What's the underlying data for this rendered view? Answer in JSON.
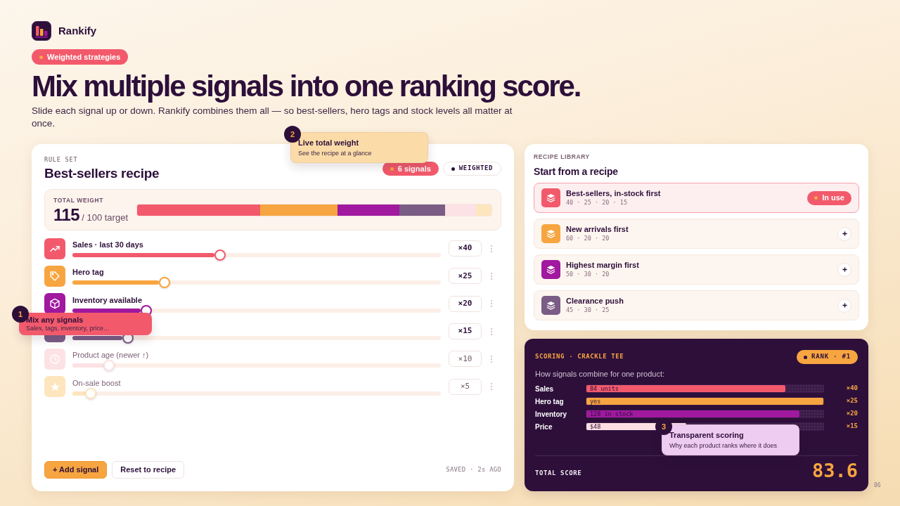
{
  "brand": {
    "name": "Rankify"
  },
  "hero": {
    "tag": "Weighted strategies",
    "title": "Mix multiple signals into one ranking score.",
    "subtitle": "Slide each signal up or down. Rankify combines them all — so best-sellers, hero tags and stock levels all matter at once."
  },
  "rule_set": {
    "eyebrow": "RULE SET",
    "title": "Best-sellers recipe",
    "badges": [
      {
        "kind": "count",
        "label": "6 signals"
      },
      {
        "kind": "mode",
        "label": "WEIGHTED"
      }
    ],
    "total_weight": {
      "label": "TOTAL WEIGHT",
      "value": "115",
      "target": "/ 100 target"
    },
    "signals": [
      {
        "label": "Sales · last 30 days",
        "color": "#f25a6c",
        "level": 0.4,
        "weight": "×40",
        "enabled": true
      },
      {
        "label": "Hero tag",
        "color": "#f7a540",
        "level": 0.25,
        "weight": "×25",
        "enabled": true
      },
      {
        "label": "Inventory available",
        "color": "#a0199f",
        "level": 0.2,
        "weight": "×20",
        "enabled": true
      },
      {
        "color": "#7a5c85",
        "level": 0.15,
        "weight": "×15",
        "enabled": true
      },
      {
        "label": "Product age (newer ↑)",
        "color": "#fce2e4",
        "level": 0.1,
        "weight": "×10",
        "enabled": false
      },
      {
        "label": "On-sale boost",
        "color": "#fde5bd",
        "level": 0.05,
        "weight": "×5",
        "enabled": false
      }
    ],
    "actions": [
      {
        "kind": "primary",
        "label": "+ Add signal"
      },
      {
        "kind": "secondary",
        "label": "Reset to recipe"
      }
    ],
    "save_status": "SAVED · 2s AGO"
  },
  "recipe_library": {
    "eyebrow": "RECIPE LIBRARY",
    "title": "Start from a recipe",
    "in_use_label": "In use",
    "recipes": [
      {
        "title": "Best-sellers, in-stock first",
        "weights": "40 · 25 · 20 · 15",
        "color": "#f25a6c",
        "selected": true
      },
      {
        "title": "New arrivals first",
        "weights": "60 · 20 · 20",
        "color": "#f7a540",
        "selected": false
      },
      {
        "title": "Highest margin first",
        "weights": "50 · 30 · 20",
        "color": "#a0199f",
        "selected": false
      },
      {
        "title": "Clearance push",
        "weights": "45 · 30 · 25",
        "color": "#7a5c85",
        "selected": false
      }
    ]
  },
  "scoring": {
    "eyebrow": "SCORING · CRACKLE TEE",
    "rank": "RANK · #1",
    "intro": "How signals combine for one product:",
    "factors": [
      {
        "label": "Sales",
        "value": "84 units",
        "level": 0.84,
        "color": "#f25a6c",
        "weight": "×40"
      },
      {
        "label": "Hero tag",
        "value": "yes",
        "level": 1.0,
        "color": "#f7a540",
        "weight": "×25"
      },
      {
        "label": "Inventory",
        "value": "128 in stock",
        "level": 0.9,
        "color": "#a0199f",
        "weight": "×20"
      },
      {
        "label": "Price",
        "value": "$48",
        "level": 0.42,
        "color": "#fbdfe3",
        "weight": "×15"
      }
    ],
    "total_label": "TOTAL SCORE",
    "total": "83.6"
  },
  "page_number": "06",
  "callouts": [
    {
      "number": "1",
      "title": "Mix any signals",
      "text": "Sales, tags, inventory, price…",
      "color": "#f25a6c"
    },
    {
      "number": "2",
      "title": "Live total weight",
      "text": "See the recipe at a glance",
      "color": "#fbdca8"
    },
    {
      "number": "3",
      "title": "Transparent scoring",
      "text": "Why each product ranks where it does",
      "color": "#eecbf0"
    }
  ]
}
